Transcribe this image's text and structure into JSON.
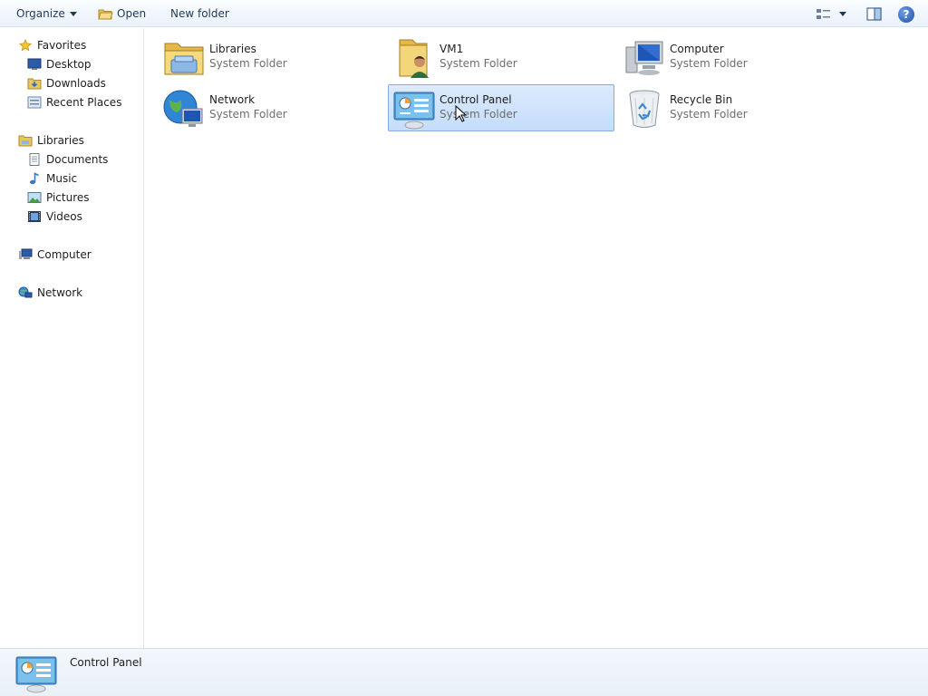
{
  "toolbar": {
    "organize_label": "Organize",
    "open_label": "Open",
    "new_folder_label": "New folder"
  },
  "nav": {
    "favorites": {
      "label": "Favorites",
      "items": [
        {
          "label": "Desktop",
          "icon": "desktop-icon"
        },
        {
          "label": "Downloads",
          "icon": "downloads-folder-icon"
        },
        {
          "label": "Recent Places",
          "icon": "recent-places-icon"
        }
      ]
    },
    "libraries": {
      "label": "Libraries",
      "items": [
        {
          "label": "Documents",
          "icon": "documents-icon"
        },
        {
          "label": "Music",
          "icon": "music-icon"
        },
        {
          "label": "Pictures",
          "icon": "pictures-icon"
        },
        {
          "label": "Videos",
          "icon": "videos-icon"
        }
      ]
    },
    "computer": {
      "label": "Computer"
    },
    "network": {
      "label": "Network"
    }
  },
  "items": [
    {
      "name": "Libraries",
      "type": "System Folder",
      "icon": "libraries-icon",
      "selected": false
    },
    {
      "name": "VM1",
      "type": "System Folder",
      "icon": "user-folder-icon",
      "selected": false
    },
    {
      "name": "Computer",
      "type": "System Folder",
      "icon": "computer-icon",
      "selected": false
    },
    {
      "name": "Network",
      "type": "System Folder",
      "icon": "network-globe-icon",
      "selected": false
    },
    {
      "name": "Control Panel",
      "type": "System Folder",
      "icon": "control-panel-icon",
      "selected": true
    },
    {
      "name": "Recycle Bin",
      "type": "System Folder",
      "icon": "recycle-bin-icon",
      "selected": false
    }
  ],
  "details": {
    "name": "Control Panel"
  },
  "colors": {
    "selection_bg": "#c4ddfb",
    "selection_border": "#84acdd",
    "secondary_text": "#6d6d6d"
  }
}
